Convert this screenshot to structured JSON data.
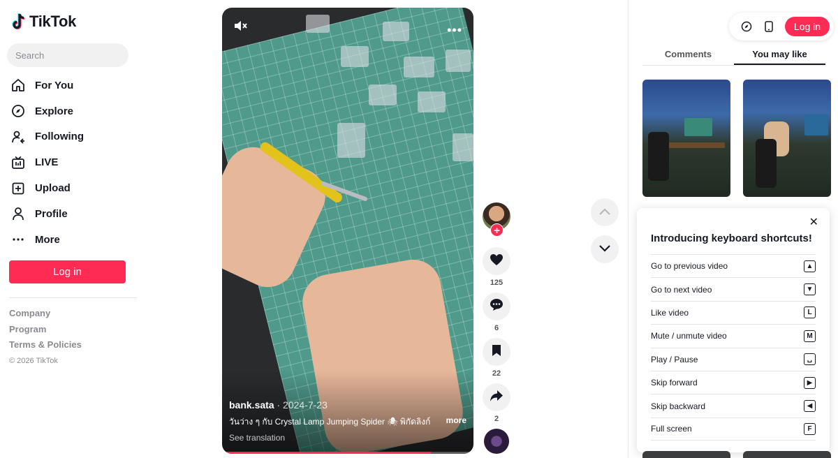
{
  "brand": {
    "name": "TikTok",
    "accent": "#fe2c55"
  },
  "search": {
    "placeholder": "Search"
  },
  "nav": [
    {
      "label": "For You",
      "icon": "home-icon"
    },
    {
      "label": "Explore",
      "icon": "compass-icon"
    },
    {
      "label": "Following",
      "icon": "following-icon"
    },
    {
      "label": "LIVE",
      "icon": "live-icon"
    },
    {
      "label": "Upload",
      "icon": "upload-icon"
    },
    {
      "label": "Profile",
      "icon": "profile-icon"
    },
    {
      "label": "More",
      "icon": "more-icon"
    }
  ],
  "sidebar": {
    "login_label": "Log in"
  },
  "footer": {
    "links": [
      "Company",
      "Program",
      "Terms & Policies"
    ],
    "copyright": "© 2026 TikTok"
  },
  "video": {
    "username": "bank.sata",
    "date": "2024-7-23",
    "caption": "วันว่าง ๆ กับ Crystal Lamp Jumping Spider 🕷 พิกัดลิงก์",
    "more_label": "more",
    "translation_label": "See translation",
    "progress": 0.83
  },
  "actions": {
    "likes": "125",
    "comments": "6",
    "saves": "22",
    "shares": "2"
  },
  "topbar": {
    "login_label": "Log in"
  },
  "tabs": [
    {
      "label": "Comments",
      "active": false
    },
    {
      "label": "You may like",
      "active": true
    }
  ],
  "shortcuts": {
    "title": "Introducing keyboard shortcuts!",
    "close_icon": "close-icon",
    "items": [
      {
        "label": "Go to previous video",
        "key": "▲"
      },
      {
        "label": "Go to next video",
        "key": "▼"
      },
      {
        "label": "Like video",
        "key": "L"
      },
      {
        "label": "Mute / unmute video",
        "key": "M"
      },
      {
        "label": "Play / Pause",
        "key": "␣"
      },
      {
        "label": "Skip forward",
        "key": "▶"
      },
      {
        "label": "Skip backward",
        "key": "◀"
      },
      {
        "label": "Full screen",
        "key": "F"
      }
    ]
  }
}
